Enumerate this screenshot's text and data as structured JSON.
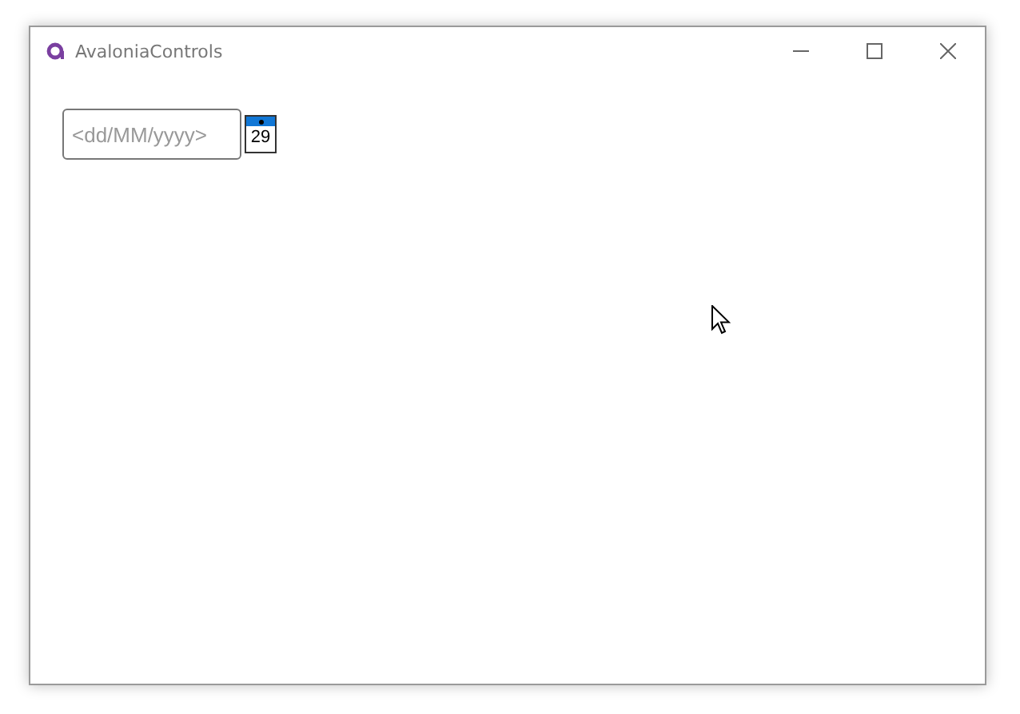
{
  "window": {
    "title": "AvaloniaControls"
  },
  "date_picker": {
    "placeholder": "<dd/MM/yyyy>",
    "calendar_day": "29"
  }
}
